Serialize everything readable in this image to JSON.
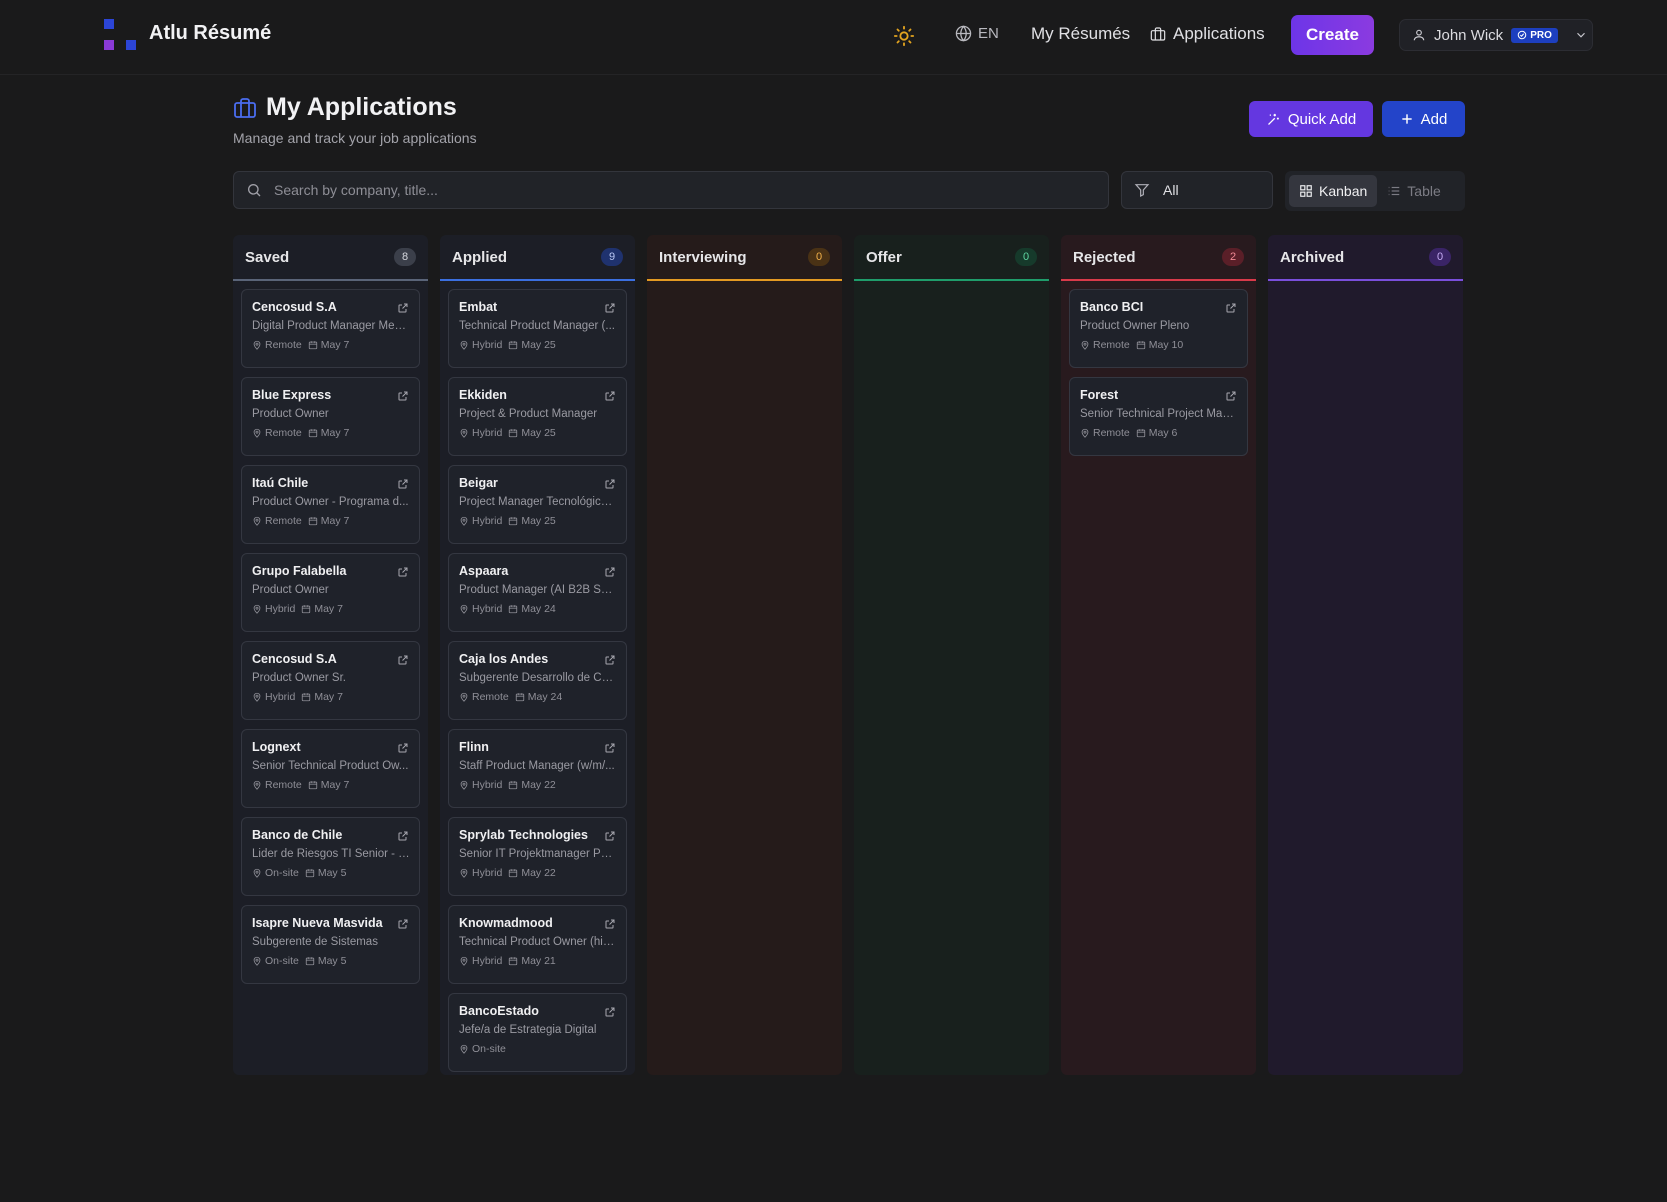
{
  "header": {
    "brand": "Atlu Résumé",
    "lang": "EN",
    "nav": {
      "my_resumes": "My Résumés",
      "applications": "Applications",
      "create": "Create"
    },
    "user": {
      "name": "John Wick",
      "badge": "PRO"
    }
  },
  "page": {
    "title": "My Applications",
    "subtitle": "Manage and track your job applications",
    "quick_add": "Quick Add",
    "add": "Add"
  },
  "toolbar": {
    "search_placeholder": "Search by company, title...",
    "filter_value": "All",
    "view_kanban": "Kanban",
    "view_table": "Table"
  },
  "colors": {
    "saved": "#5a6478",
    "applied": "#3b6fe0",
    "interviewing": "#e39a22",
    "offer": "#1f9d6b",
    "rejected": "#d93a4a",
    "archived": "#7a4fdc"
  },
  "columns": [
    {
      "key": "saved",
      "title": "Saved",
      "count": "8",
      "cards": [
        {
          "company": "Cencosud S.A",
          "title": "Digital Product Manager Medi...",
          "mode": "Remote",
          "date": "May 7"
        },
        {
          "company": "Blue Express",
          "title": "Product Owner",
          "mode": "Remote",
          "date": "May 7"
        },
        {
          "company": "Itaú Chile",
          "title": "Product Owner - Programa d...",
          "mode": "Remote",
          "date": "May 7"
        },
        {
          "company": "Grupo Falabella",
          "title": "Product Owner",
          "mode": "Hybrid",
          "date": "May 7"
        },
        {
          "company": "Cencosud S.A",
          "title": "Product Owner Sr.",
          "mode": "Hybrid",
          "date": "May 7"
        },
        {
          "company": "Lognext",
          "title": "Senior Technical Product Ow...",
          "mode": "Remote",
          "date": "May 7"
        },
        {
          "company": "Banco de Chile",
          "title": "Lider de Riesgos TI Senior - C...",
          "mode": "On-site",
          "date": "May 5"
        },
        {
          "company": "Isapre Nueva Masvida",
          "title": "Subgerente de Sistemas",
          "mode": "On-site",
          "date": "May 5"
        }
      ]
    },
    {
      "key": "applied",
      "title": "Applied",
      "count": "9",
      "cards": [
        {
          "company": "Embat",
          "title": "Technical Product Manager (...",
          "mode": "Hybrid",
          "date": "May 25"
        },
        {
          "company": "Ekkiden",
          "title": "Project & Product Manager",
          "mode": "Hybrid",
          "date": "May 25"
        },
        {
          "company": "Beigar",
          "title": "Project Manager Tecnológico ...",
          "mode": "Hybrid",
          "date": "May 25"
        },
        {
          "company": "Aspaara",
          "title": "Product Manager (AI B2B Saa...",
          "mode": "Hybrid",
          "date": "May 24"
        },
        {
          "company": "Caja los Andes",
          "title": "Subgerente Desarrollo de Ca...",
          "mode": "Remote",
          "date": "May 24"
        },
        {
          "company": "Flinn",
          "title": "Staff Product Manager (w/m/...",
          "mode": "Hybrid",
          "date": "May 22"
        },
        {
          "company": "Sprylab Technologies",
          "title": "Senior IT Projektmanager Pur...",
          "mode": "Hybrid",
          "date": "May 22"
        },
        {
          "company": "Knowmadmood",
          "title": "Technical Product Owner (hib...",
          "mode": "Hybrid",
          "date": "May 21"
        },
        {
          "company": "BancoEstado",
          "title": "Jefe/a de Estrategia Digital",
          "mode": "On-site",
          "date": ""
        }
      ]
    },
    {
      "key": "interviewing",
      "title": "Interviewing",
      "count": "0",
      "cards": []
    },
    {
      "key": "offer",
      "title": "Offer",
      "count": "0",
      "cards": []
    },
    {
      "key": "rejected",
      "title": "Rejected",
      "count": "2",
      "cards": [
        {
          "company": "Banco BCI",
          "title": "Product Owner Pleno",
          "mode": "Remote",
          "date": "May 10"
        },
        {
          "company": "Forest",
          "title": "Senior Technical Project Man...",
          "mode": "Remote",
          "date": "May 6"
        }
      ]
    },
    {
      "key": "archived",
      "title": "Archived",
      "count": "0",
      "cards": []
    }
  ]
}
